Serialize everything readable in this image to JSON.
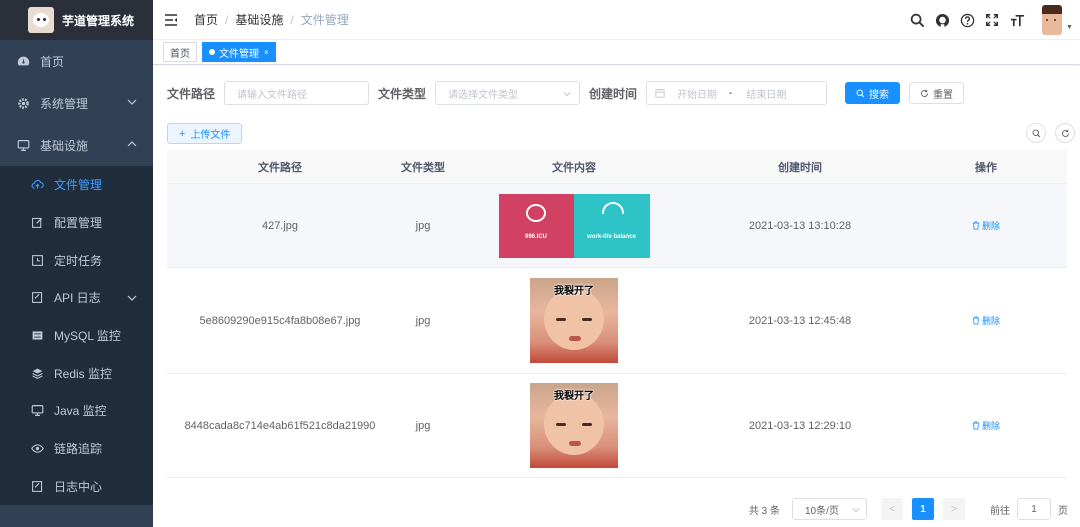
{
  "app": {
    "title": "芋道管理系统"
  },
  "sidebar": {
    "items": [
      {
        "label": "首页",
        "icon": "dashboard-icon"
      },
      {
        "label": "系统管理",
        "icon": "gear-icon"
      },
      {
        "label": "基础设施",
        "icon": "monitor-icon"
      }
    ],
    "sub_items": [
      {
        "label": "文件管理",
        "icon": "cloud-upload-icon"
      },
      {
        "label": "配置管理",
        "icon": "edit-icon"
      },
      {
        "label": "定时任务",
        "icon": "job-icon"
      },
      {
        "label": "API 日志",
        "icon": "form-icon"
      },
      {
        "label": "MySQL 监控",
        "icon": "server-icon"
      },
      {
        "label": "Redis 监控",
        "icon": "redis-icon"
      },
      {
        "label": "Java 监控",
        "icon": "monitor-icon"
      },
      {
        "label": "链路追踪",
        "icon": "eye-icon"
      },
      {
        "label": "日志中心",
        "icon": "log-icon"
      }
    ]
  },
  "breadcrumb": {
    "items": [
      "首页",
      "基础设施",
      "文件管理"
    ]
  },
  "tags": {
    "items": [
      "首页",
      "文件管理"
    ]
  },
  "search_form": {
    "path_label": "文件路径",
    "path_placeholder": "请输入文件路径",
    "type_label": "文件类型",
    "type_placeholder": "请选择文件类型",
    "time_label": "创建时间",
    "start_placeholder": "开始日期",
    "range_sep": "-",
    "end_placeholder": "结束日期",
    "search_label": "搜索",
    "reset_label": "重置"
  },
  "toolbar": {
    "upload_label": "上传文件"
  },
  "table": {
    "headers": [
      "文件路径",
      "文件类型",
      "文件内容",
      "创建时间",
      "操作"
    ],
    "rows": [
      {
        "path": "427.jpg",
        "type": "jpg",
        "time": "2021-03-13 13:10:28",
        "action": "删除",
        "image_captions": [
          "996.ICU",
          "work-life balance"
        ]
      },
      {
        "path": "5e8609290e915c4fa8b08e67.jpg",
        "type": "jpg",
        "time": "2021-03-13 12:45:48",
        "action": "删除",
        "image_captions": [
          "我裂开了"
        ]
      },
      {
        "path": "8448cada8c714e4ab61f521c8da21990",
        "type": "jpg",
        "time": "2021-03-13 12:29:10",
        "action": "删除",
        "image_captions": [
          "我裂开了"
        ]
      }
    ]
  },
  "pagination": {
    "total_text": "共 3 条",
    "page_size": "10条/页",
    "current_page": "1",
    "prev": "<",
    "next": ">",
    "goto_label": "前往",
    "goto_value": "1",
    "page_unit": "页"
  },
  "colors": {
    "sidebar_bg": "#304156",
    "active": "#409eff",
    "primary": "#1890ff"
  }
}
